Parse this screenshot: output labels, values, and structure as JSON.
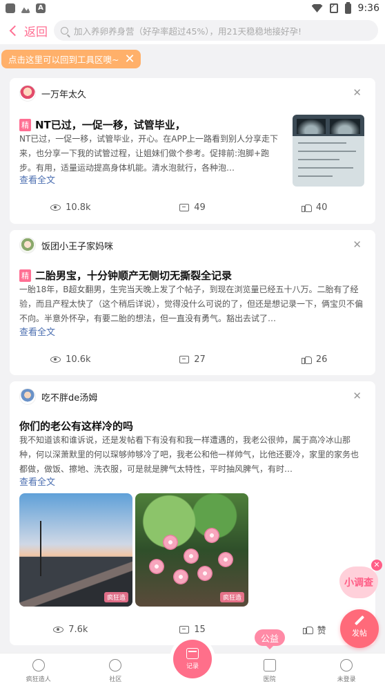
{
  "status": {
    "time": "9:36"
  },
  "nav": {
    "back_label": "返回",
    "search_placeholder": "加入养卵养身营（好孕率超过45%），用21天稳稳地接好孕!"
  },
  "tooltip": {
    "text": "点击这里可以回到工具区噢~"
  },
  "posts": [
    {
      "author": "一万年太久",
      "badge": "精",
      "title": "NT已过，一促一移，试管毕业，",
      "body": "NT已过，一促一移，试管毕业，开心。在APP上一路看到别人分享走下来，也分享一下我的试管过程，让姐妹们做个参考。促排前:泡脚+跑步。有用，适量运动提高身体机能。清水泡就行，各种泡…",
      "more": "查看全文",
      "views": "10.8k",
      "comments": "49",
      "likes": "40"
    },
    {
      "author": "饭团小王子家妈咪",
      "badge": "精",
      "title": "二胎男宝，十分钟顺产无侧切无撕裂全记录",
      "body": "一胎18年，B超女翻男，生完当天晚上发了个帖子，到现在浏览量已经五十八万。二胎有了经验，而且产程太快了（这个稍后详说），觉得没什么可说的了，但还是想记录一下，俩宝贝不偏不向。半意外怀孕，有要二胎的想法，但一直没有勇气。豁出去试了…",
      "more": "查看全文",
      "views": "10.6k",
      "comments": "27",
      "likes": "26"
    },
    {
      "author": "吃不胖de汤姆",
      "title": "你们的老公有这样冷的吗",
      "body": "我不知道该和谁诉说，还是发帖看下有没有和我一样遭遇的，我老公很帅，属于高冷冰山那种，何以深萧默里的何以琛够帅够冷了吧，我老公和他一样帅气，比他还要冷，家里的家务也都做，做饭、擦地、洗衣服，可是就是脾气太特性，平时抽风脾气，有时…",
      "more": "查看全文",
      "views": "7.6k",
      "comments": "15",
      "likes": "赞",
      "photo_watermark": "疯狂造"
    }
  ],
  "floating": {
    "survey": "小调查",
    "post": "发帖",
    "gongyi": "公益"
  },
  "tabbar": {
    "items": [
      "疯狂造人",
      "社区",
      "记录",
      "医院",
      "未登录"
    ]
  },
  "colors": {
    "accent": "#ff6f93",
    "tooltip": "#ffb06a",
    "link": "#4c6fb1"
  }
}
